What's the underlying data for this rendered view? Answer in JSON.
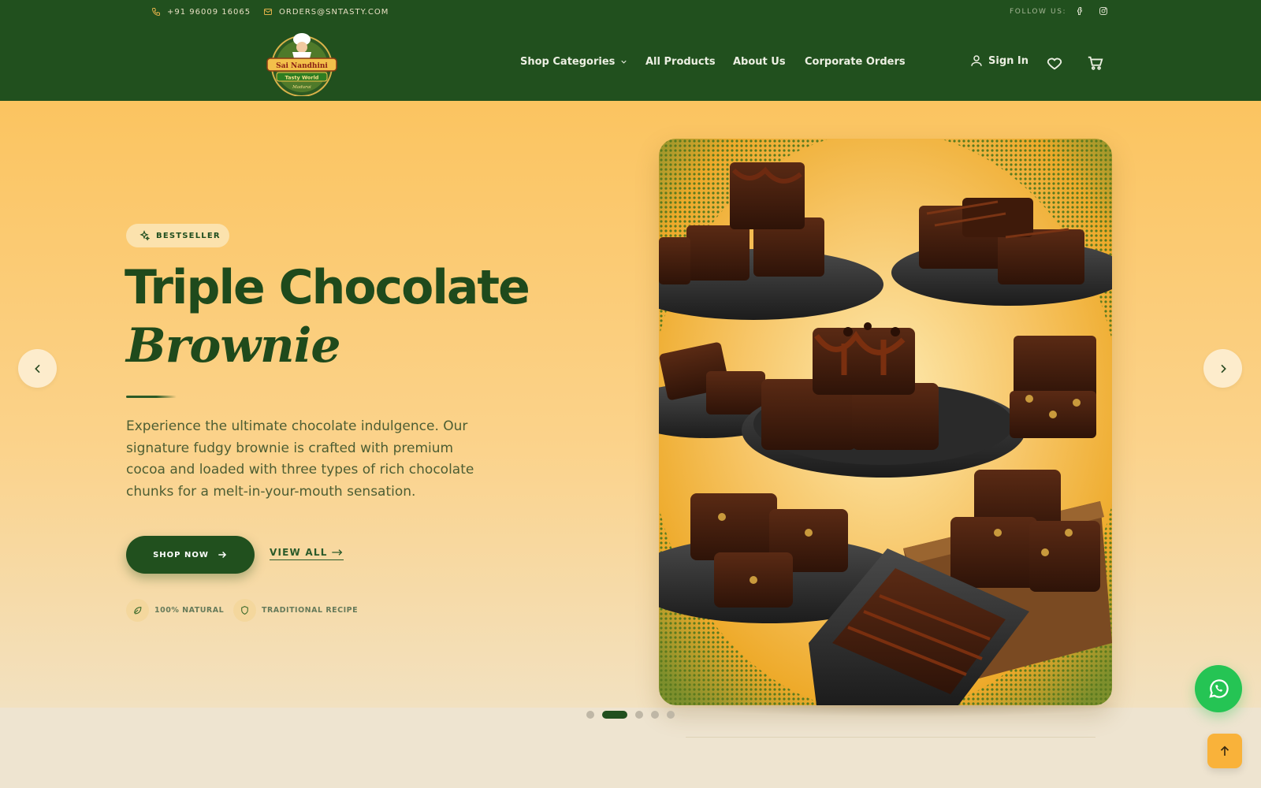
{
  "topbar": {
    "phone": "+91 96009 16065",
    "email": "ORDERS@SNTASTY.COM",
    "follow_label": "FOLLOW US:",
    "icons": [
      "phone-icon",
      "mail-icon",
      "facebook-icon",
      "instagram-icon"
    ]
  },
  "brand": {
    "logo_line1": "Sai Nandhini",
    "logo_line2": "Tasty World",
    "logo_line3": "Madurai"
  },
  "nav": {
    "items": [
      {
        "label": "Shop Categories",
        "has_dropdown": true
      },
      {
        "label": "All Products"
      },
      {
        "label": "About Us"
      },
      {
        "label": "Corporate Orders"
      }
    ],
    "sign_in": "Sign In",
    "icons": [
      "user-icon",
      "heart-icon",
      "cart-icon"
    ]
  },
  "hero": {
    "badge": "BESTSELLER",
    "title_line1": "Triple Chocolate",
    "title_line2": "Brownie",
    "description": "Experience the ultimate chocolate indulgence. Our signature fudgy brownie is crafted with premium cocoa and loaded with three types of rich chocolate chunks for a melt-in-your-mouth sensation.",
    "primary_cta": "SHOP NOW",
    "secondary_cta": "VIEW ALL",
    "features": [
      "100% NATURAL",
      "TRADITIONAL RECIPE"
    ],
    "slide_count": 5,
    "active_slide": 2
  },
  "colors": {
    "brand_green": "#21501e",
    "hero_yellow": "#fbc460",
    "whatsapp": "#25c454",
    "accent_orange": "#f9b23a"
  }
}
